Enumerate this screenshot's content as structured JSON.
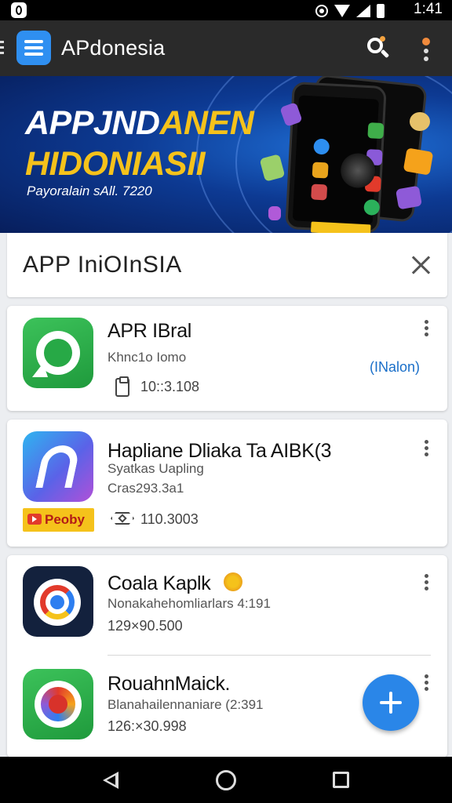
{
  "status_bar": {
    "time": "1:41"
  },
  "app_bar": {
    "title": "APdonesia"
  },
  "banner": {
    "line1_white": "APPJND",
    "line1_yellow": "ANEN",
    "line2": "HIDONIASII",
    "subtitle": "Payoralain sAll. 7220"
  },
  "section": {
    "title": "APP IniOInSIA"
  },
  "apps": [
    {
      "name": "APR IBral",
      "developer": "Khnc1o Iomo",
      "meta": "10::3.108",
      "action": "(INalon)"
    },
    {
      "name": "Hapliane Dliaka Ta AIBK(3",
      "developer": "Syatkas Uapling",
      "sub2": "Cras293.3a1",
      "badge": "Peoby",
      "meta": "110.3003"
    },
    {
      "name": "Coala Kaplk",
      "developer": "Nonakahehomliarlars 4:191",
      "meta": "129×90.500"
    },
    {
      "name": "RouahnMaick.",
      "developer": "Blanahailennaniare (2:391",
      "meta": "126:×30.998"
    }
  ],
  "colors": {
    "app_bar": "#2a2a2a",
    "accent_blue": "#2a86e8",
    "banner_yellow": "#f5c21b",
    "link_blue": "#1a6fc9"
  }
}
